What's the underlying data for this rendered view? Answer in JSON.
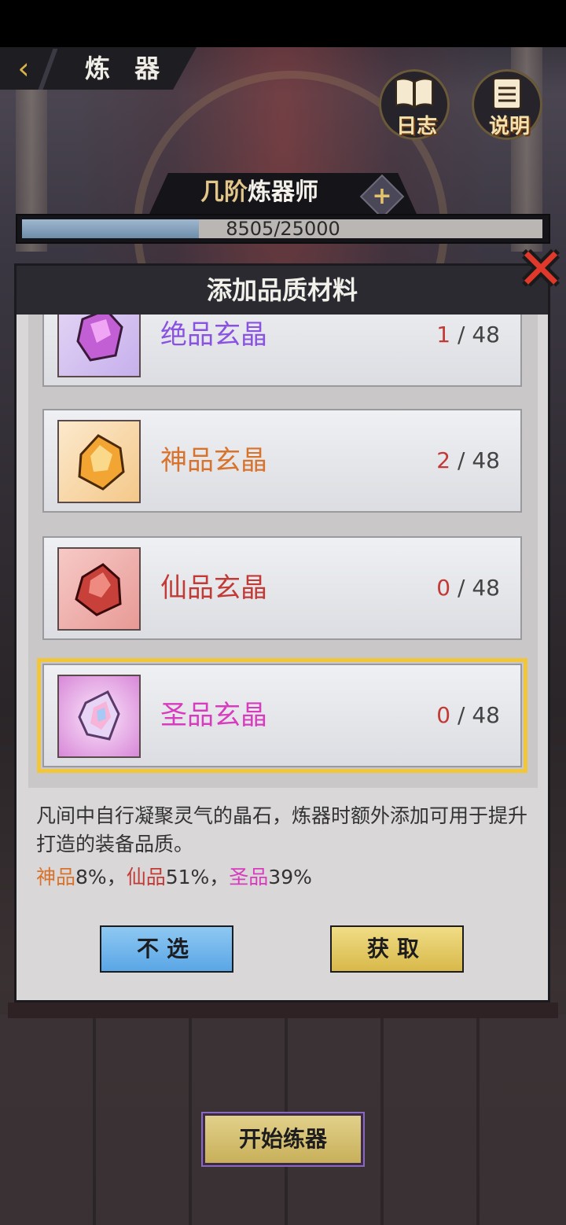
{
  "header": {
    "back_icon": "chevron-left-icon",
    "title": "炼 器"
  },
  "top_buttons": {
    "log_label": "日志",
    "log_icon": "book-icon",
    "help_label": "说明",
    "help_icon": "document-icon"
  },
  "rank": {
    "prefix": "几阶",
    "title": "炼器师",
    "plus_icon": "plus-icon",
    "plus_symbol": "+"
  },
  "exp": {
    "current": 8505,
    "max": 25000,
    "progress": 0.34,
    "text": "8505/25000"
  },
  "dialog": {
    "title": "添加品质材料",
    "close_icon": "close-icon",
    "close_symbol": "✕"
  },
  "materials": [
    {
      "name": "绝品玄晶",
      "have": "1",
      "need": "48",
      "name_color": "#8a52e0",
      "icon": "purple-crystal-icon",
      "selected": false
    },
    {
      "name": "神品玄晶",
      "have": "2",
      "need": "48",
      "name_color": "#d8732d",
      "icon": "orange-crystal-icon",
      "selected": false
    },
    {
      "name": "仙品玄晶",
      "have": "0",
      "need": "48",
      "name_color": "#c23a36",
      "icon": "red-crystal-icon",
      "selected": false
    },
    {
      "name": "圣品玄晶",
      "have": "0",
      "need": "48",
      "name_color": "#d83cbe",
      "icon": "rainbow-crystal-icon",
      "selected": true
    }
  ],
  "count_separator": "/",
  "description": "凡间中自行凝聚灵气的晶石，炼器时额外添加可用于提升打造的装备品质。",
  "rates": {
    "shen_label": "神品",
    "shen_value": "8%，",
    "xian_label": "仙品",
    "xian_value": "51%，",
    "sheng_label": "圣品",
    "sheng_value": "39%"
  },
  "buttons": {
    "skip": "不选",
    "obtain": "获取",
    "start": "开始练器"
  }
}
